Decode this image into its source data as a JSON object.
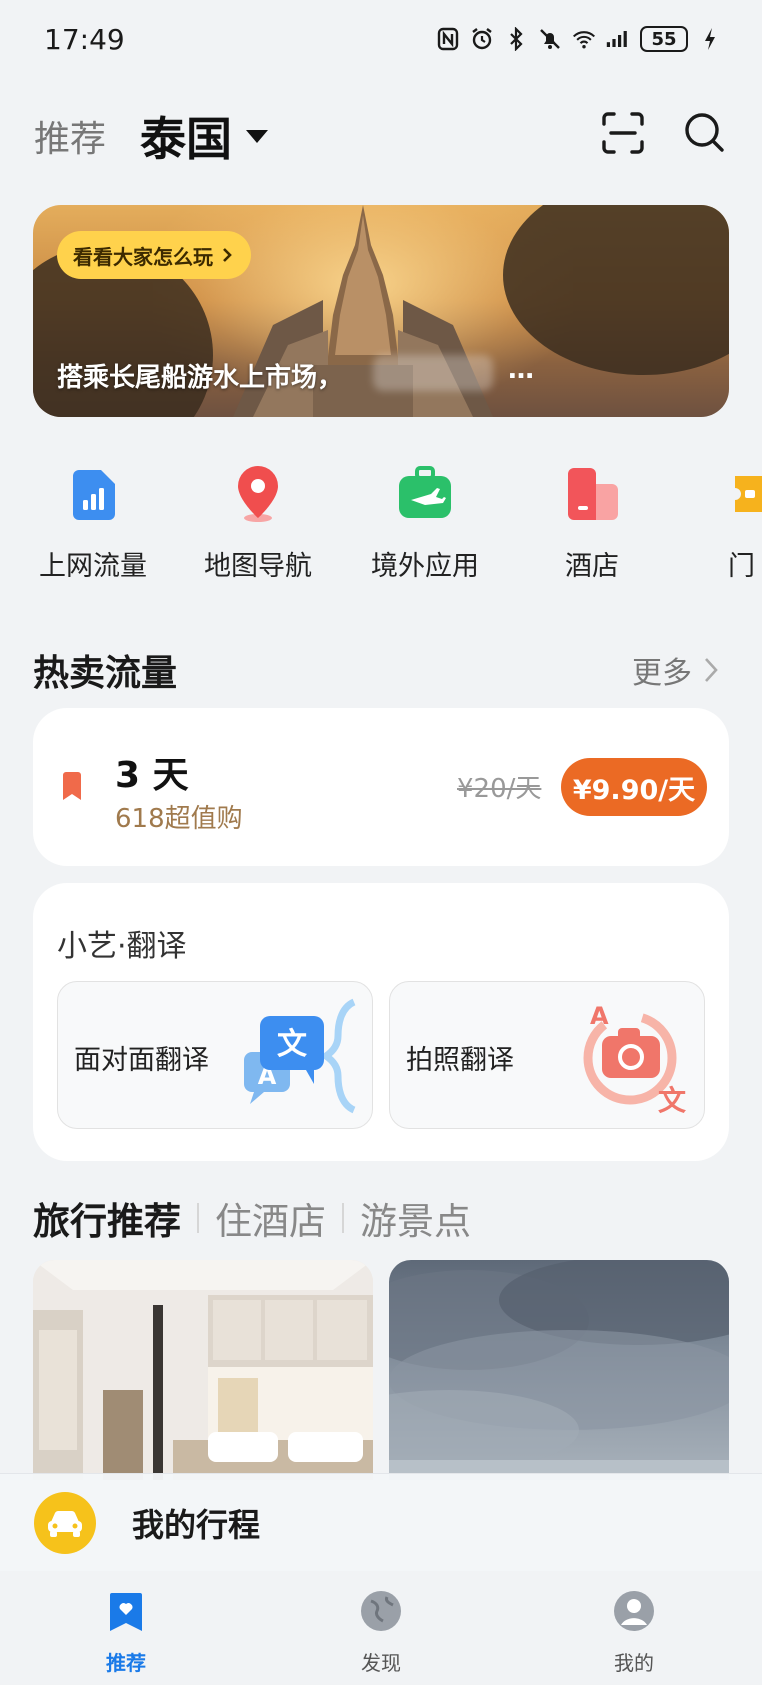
{
  "status_bar": {
    "time": "17:49",
    "battery": "55"
  },
  "header": {
    "tab_label": "推荐",
    "region": "泰国",
    "icons": [
      "scan-icon",
      "search-icon"
    ]
  },
  "banner": {
    "pill_label": "看看大家怎么玩",
    "caption": "搭乘长尾船游水上市场，",
    "ellipsis": "…"
  },
  "quick_entries": [
    {
      "label": "上网流量",
      "icon": "data-signal-icon",
      "color": "#3d8ef0"
    },
    {
      "label": "地图导航",
      "icon": "map-pin-icon",
      "color": "#f04e4e"
    },
    {
      "label": "境外应用",
      "icon": "travel-bag-icon",
      "color": "#2bc06a"
    },
    {
      "label": "酒店",
      "icon": "hotel-icon",
      "color": "#f2555a"
    },
    {
      "label": "门",
      "icon": "ticket-icon",
      "color": "#f6b21d"
    }
  ],
  "hot_data": {
    "title": "热卖流量",
    "more_label": "更多",
    "plan": {
      "duration": "3 天",
      "promo": "618超值购",
      "original_price": "¥20/天",
      "price": "¥9.90/天"
    }
  },
  "translate": {
    "title": "小艺·翻译",
    "options": [
      {
        "label": "面对面翻译",
        "icon": "face-to-face-translate-icon"
      },
      {
        "label": "拍照翻译",
        "icon": "photo-translate-icon"
      }
    ]
  },
  "travel": {
    "tabs": [
      "旅行推荐",
      "住酒店",
      "游景点"
    ],
    "active_tab": "旅行推荐"
  },
  "itinerary": {
    "label": "我的行程"
  },
  "bottom_nav": [
    {
      "label": "推荐",
      "icon": "recommend-icon",
      "active": true
    },
    {
      "label": "发现",
      "icon": "globe-icon",
      "active": false
    },
    {
      "label": "我的",
      "icon": "profile-icon",
      "active": false
    }
  ],
  "colors": {
    "accent": "#1a7ae8",
    "price_button": "#eb6a24",
    "promo_text": "#a07a4d",
    "pill": "#ffd24c"
  }
}
